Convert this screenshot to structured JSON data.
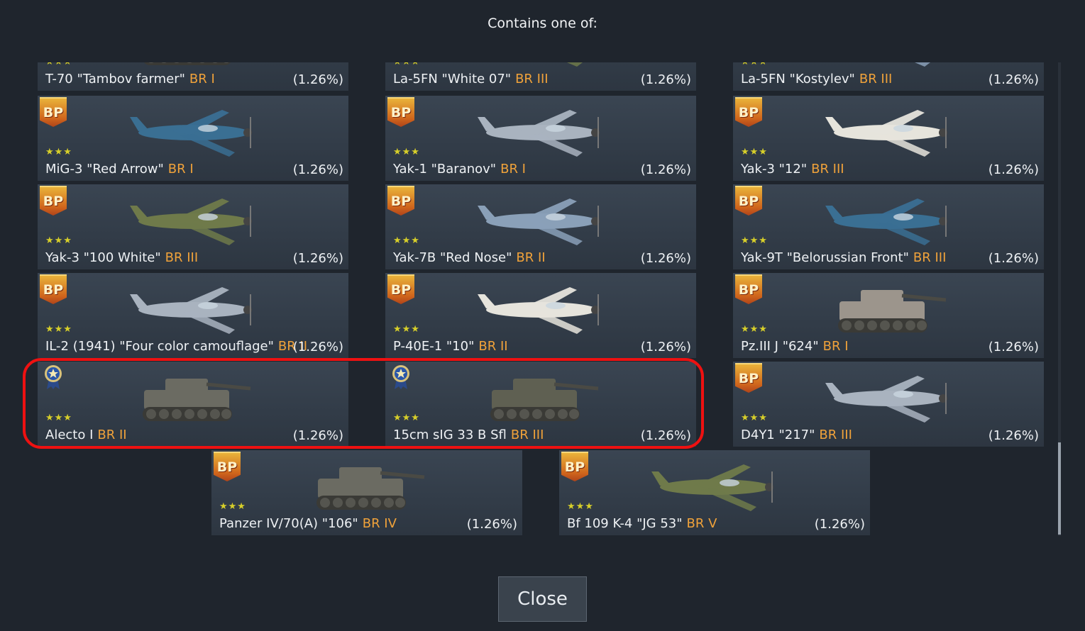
{
  "dialog": {
    "heading": "Contains one of:",
    "close_label": "Close"
  },
  "items": [
    {
      "name": "T-70 \"Tambov farmer\"",
      "br": "BR I",
      "chance": "(1.26%)",
      "badge": "bp-icon",
      "kind": "tank"
    },
    {
      "name": "La-5FN \"White 07\"",
      "br": "BR III",
      "chance": "(1.26%)",
      "badge": "bp-icon",
      "kind": "plane"
    },
    {
      "name": "La-5FN \"Kostylev\"",
      "br": "BR III",
      "chance": "(1.26%)",
      "badge": "bp-icon",
      "kind": "plane"
    },
    {
      "name": "MiG-3 \"Red Arrow\"",
      "br": "BR I",
      "chance": "(1.26%)",
      "badge": "bp-icon",
      "kind": "plane"
    },
    {
      "name": "Yak-1 \"Baranov\"",
      "br": "BR I",
      "chance": "(1.26%)",
      "badge": "bp-icon",
      "kind": "plane"
    },
    {
      "name": "Yak-3 \"12\"",
      "br": "BR III",
      "chance": "(1.26%)",
      "badge": "bp-icon",
      "kind": "plane"
    },
    {
      "name": "Yak-3 \"100 White\"",
      "br": "BR III",
      "chance": "(1.26%)",
      "badge": "bp-icon",
      "kind": "plane"
    },
    {
      "name": "Yak-7B \"Red Nose\"",
      "br": "BR II",
      "chance": "(1.26%)",
      "badge": "bp-icon",
      "kind": "plane"
    },
    {
      "name": "Yak-9T \"Belorussian Front\"",
      "br": "BR III",
      "chance": "(1.26%)",
      "badge": "bp-icon",
      "kind": "plane"
    },
    {
      "name": "IL-2 (1941) \"Four color camouflage\"",
      "br": "BR II",
      "chance": "(1.26%)",
      "badge": "bp-icon",
      "kind": "plane"
    },
    {
      "name": "P-40E-1 \"10\"",
      "br": "BR II",
      "chance": "(1.26%)",
      "badge": "bp-icon",
      "kind": "plane"
    },
    {
      "name": "Pz.III J \"624\"",
      "br": "BR I",
      "chance": "(1.26%)",
      "badge": "bp-icon",
      "kind": "tank"
    },
    {
      "name": "Alecto I",
      "br": "BR II",
      "chance": "(1.26%)",
      "badge": "medal-icon",
      "kind": "tank"
    },
    {
      "name": "15cm sIG 33 B Sfl",
      "br": "BR III",
      "chance": "(1.26%)",
      "badge": "medal-icon",
      "kind": "tank"
    },
    {
      "name": "D4Y1 \"217\"",
      "br": "BR III",
      "chance": "(1.26%)",
      "badge": "bp-icon",
      "kind": "plane"
    },
    {
      "name": "Panzer IV/70(A) \"106\"",
      "br": "BR IV",
      "chance": "(1.26%)",
      "badge": "bp-icon",
      "kind": "tank"
    },
    {
      "name": "Bf 109 K-4 \"JG 53\"",
      "br": "BR V",
      "chance": "(1.26%)",
      "badge": "bp-icon",
      "kind": "plane"
    }
  ],
  "bp_badge_text": "BP",
  "stars": "★★★",
  "colors": {
    "background": "#1f252d",
    "card": "#36414d",
    "br_accent": "#f0a23a",
    "stars": "#d7cf2a",
    "highlight": "#ee1111"
  }
}
